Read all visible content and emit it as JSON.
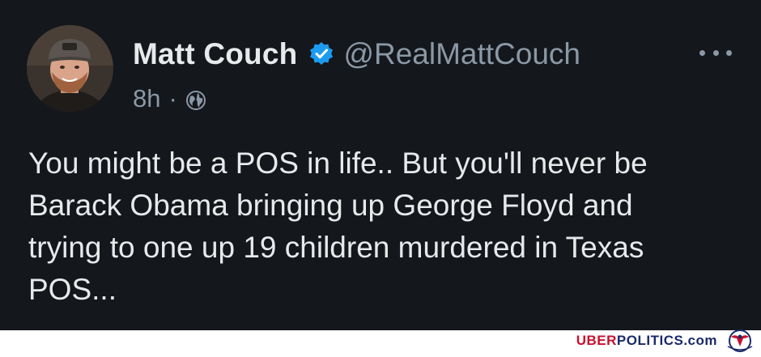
{
  "tweet": {
    "display_name": "Matt Couch",
    "handle": "@RealMattCouch",
    "time": "8h",
    "separator": "·",
    "text": "You might be a POS in life.. But you'll never be\nBarack Obama bringing up George Floyd and\ntrying to one up 19 children murdered in Texas\nPOS...",
    "verified": true,
    "icons": {
      "verified": "verified-badge-icon",
      "more": "more-horizontal-icon",
      "audience": "globe-icon"
    }
  },
  "watermark": {
    "part1": "UBER",
    "part2": "POLITICS.com",
    "logo": "eagle-seal-logo"
  },
  "colors": {
    "background": "#14171c",
    "primary_text": "#e7e9ea",
    "secondary_text": "#8b98a5",
    "verified_blue": "#1d9bf0",
    "brand_red": "#c8102e",
    "brand_blue": "#1b2a6b"
  }
}
